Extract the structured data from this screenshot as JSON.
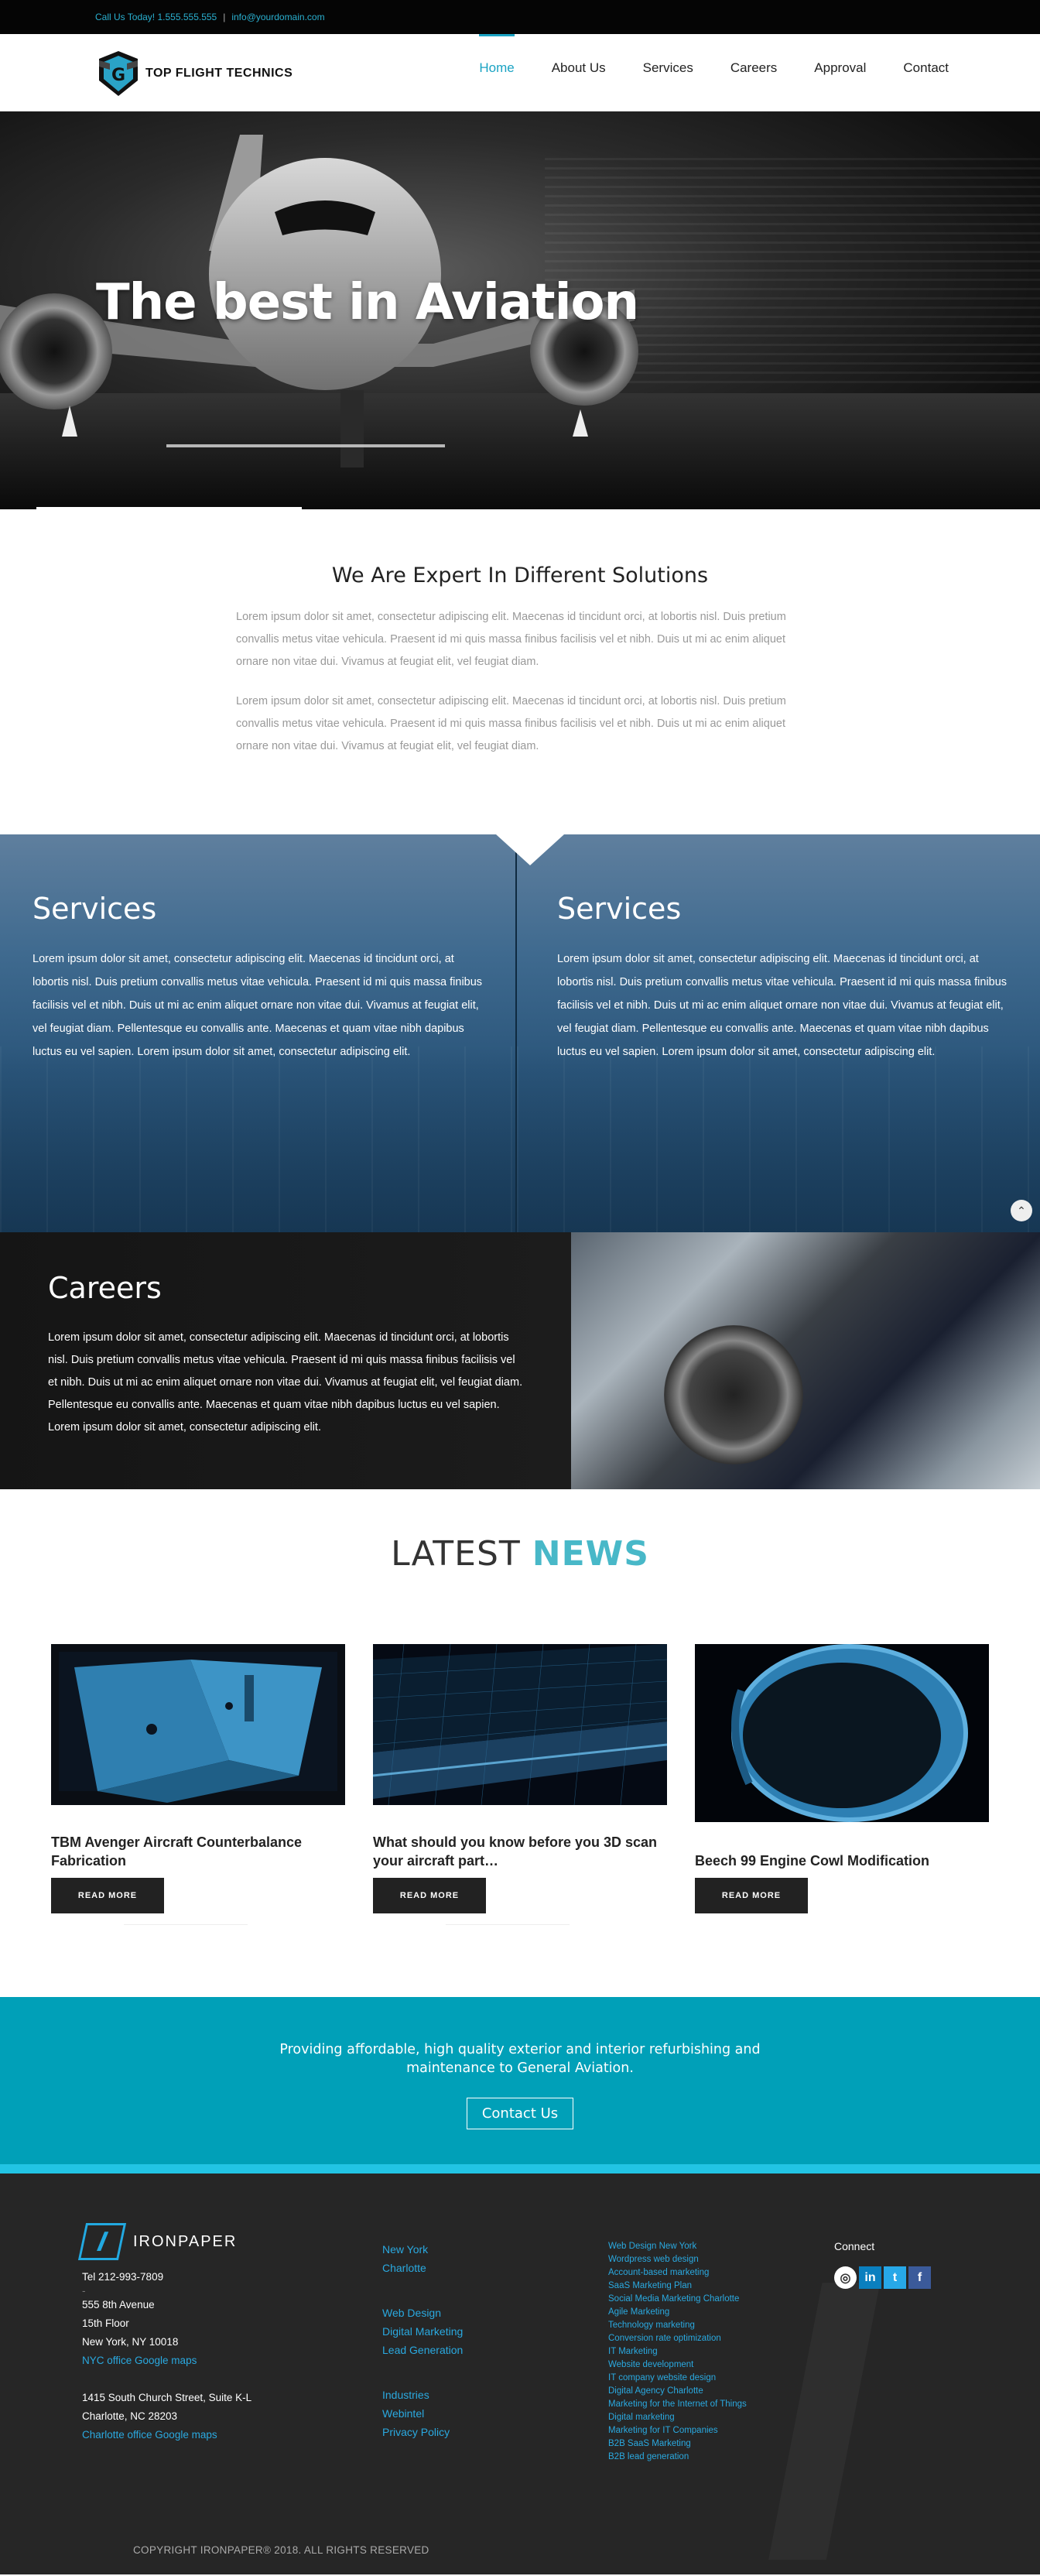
{
  "topbar": {
    "phone": "Call Us Today! 1.555.555.555",
    "separator": "|",
    "email": "info@yourdomain.com"
  },
  "header": {
    "logo_text": "TOP FLIGHT TECHNICS",
    "nav": [
      "Home",
      "About Us",
      "Services",
      "Careers",
      "Approval",
      "Contact"
    ],
    "active_nav": "Home"
  },
  "hero": {
    "title": "The best in Aviation"
  },
  "intro": {
    "heading": "We Are Expert In Different Solutions",
    "paragraphs": [
      "Lorem ipsum dolor sit amet, consectetur adipiscing elit. Maecenas id tincidunt orci, at lobortis nisl. Duis pretium convallis metus vitae vehicula. Praesent id mi quis massa finibus facilisis vel et nibh. Duis ut mi ac enim aliquet ornare non vitae dui. Vivamus at feugiat elit, vel feugiat diam.",
      "Lorem ipsum dolor sit amet, consectetur adipiscing elit. Maecenas id tincidunt orci, at lobortis nisl. Duis pretium convallis metus vitae vehicula. Praesent id mi quis massa finibus facilisis vel et nibh. Duis ut mi ac enim aliquet ornare non vitae dui. Vivamus at feugiat elit, vel feugiat diam."
    ]
  },
  "services": [
    {
      "title": "Services",
      "text": "Lorem ipsum dolor sit amet, consectetur adipiscing elit. Maecenas id tincidunt orci, at lobortis nisl. Duis pretium convallis metus vitae vehicula. Praesent id mi quis massa finibus facilisis vel et nibh. Duis ut mi ac enim aliquet ornare non vitae dui. Vivamus at feugiat elit, vel feugiat diam. Pellentesque eu convallis ante. Maecenas et quam vitae nibh dapibus luctus eu vel sapien. Lorem ipsum dolor sit amet, consectetur adipiscing elit."
    },
    {
      "title": "Services",
      "text": "Lorem ipsum dolor sit amet, consectetur adipiscing elit. Maecenas id tincidunt orci, at lobortis nisl. Duis pretium convallis metus vitae vehicula. Praesent id mi quis massa finibus facilisis vel et nibh. Duis ut mi ac enim aliquet ornare non vitae dui. Vivamus at feugiat elit, vel feugiat diam. Pellentesque eu convallis ante. Maecenas et quam vitae nibh dapibus luctus eu vel sapien. Lorem ipsum dolor sit amet, consectetur adipiscing elit."
    }
  ],
  "careers": {
    "title": "Careers",
    "text": "Lorem ipsum dolor sit amet, consectetur adipiscing elit. Maecenas id tincidunt orci, at lobortis nisl. Duis pretium convallis metus vitae vehicula. Praesent id mi quis massa finibus facilisis vel et nibh. Duis ut mi ac enim aliquet ornare non vitae dui. Vivamus at feugiat elit, vel feugiat diam. Pellentesque eu convallis ante. Maecenas et quam vitae nibh dapibus luctus eu vel sapien. Lorem ipsum dolor sit amet, consectetur adipiscing elit."
  },
  "news": {
    "heading_plain": "LATEST ",
    "heading_accent": "NEWS",
    "items": [
      {
        "title": "TBM Avenger Aircraft Counterbalance Fabrication",
        "button": "READ MORE"
      },
      {
        "title": "What should you know before you 3D scan your aircraft part…",
        "button": "READ MORE"
      },
      {
        "title": "Beech 99 Engine Cowl Modification",
        "button": "READ MORE"
      }
    ]
  },
  "cta": {
    "text_line1": "Providing affordable, high quality exterior and interior refurbishing and",
    "text_line2": "maintenance to General Aviation.",
    "button": "Contact Us"
  },
  "footer": {
    "brand": "IRONPAPER",
    "phone": "Tel 212-993-7809",
    "dash": "-",
    "ny_address": [
      "555 8th Avenue",
      "15th Floor",
      "New York, NY 10018"
    ],
    "ny_map": "NYC office Google maps",
    "clt_address": [
      "1415 South Church Street, Suite K-L",
      "Charlotte, NC 28203"
    ],
    "clt_map": "Charlotte office Google maps",
    "locations": [
      "New York",
      "Charlotte"
    ],
    "services_links": [
      "Web Design",
      "Digital Marketing",
      "Lead Generation"
    ],
    "company_links": [
      "Industries",
      "Webintel",
      "Privacy Policy"
    ],
    "seo_links": [
      "Web Design New York",
      "Wordpress web design",
      "Account-based marketing",
      "SaaS Marketing Plan",
      "Social Media Marketing Charlotte",
      "Agile Marketing",
      "Technology marketing",
      "Conversion rate optimization",
      "IT Marketing",
      "Website development",
      "IT company website design",
      "Digital Agency Charlotte",
      "Marketing for the Internet of Things",
      "Digital marketing",
      "Marketing for IT Companies",
      "B2B SaaS Marketing",
      "B2B lead generation"
    ],
    "connect_label": "Connect",
    "copyright": "COPYRIGHT IRONPAPER® 2018. ALL RIGHTS RESERVED"
  }
}
